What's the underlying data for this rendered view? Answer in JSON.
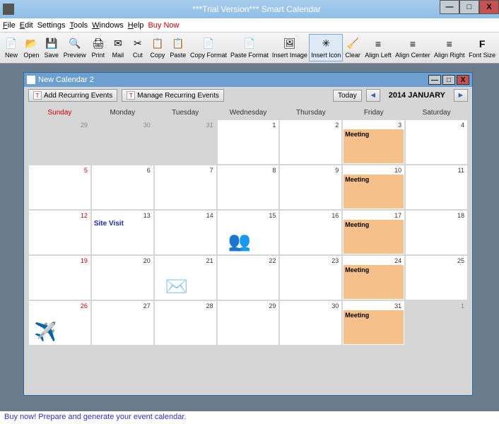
{
  "window": {
    "title": "***Trial Version*** Smart Calendar",
    "min": "—",
    "max": "□",
    "close": "X"
  },
  "menu": {
    "file": "File",
    "edit": "Edit",
    "settings": "Settings",
    "tools": "Tools",
    "windows": "Windows",
    "help": "Help",
    "buy": "Buy Now"
  },
  "toolbar": {
    "new": "New",
    "open": "Open",
    "save": "Save",
    "preview": "Preview",
    "print": "Print",
    "mail": "Mail",
    "cut": "Cut",
    "copy": "Copy",
    "paste": "Paste",
    "copyfmt": "Copy Format",
    "pastefmt": "Paste Format",
    "insertimg": "Insert Image",
    "inserticon": "Insert Icon",
    "clear": "Clear",
    "alignl": "Align Left",
    "alignc": "Align Center",
    "alignr": "Align Right",
    "fontsize": "Font Size"
  },
  "subwindow": {
    "title": "New Calendar 2",
    "addrecur": "Add Recurring Events",
    "managerecur": "Manage Recurring Events",
    "today": "Today",
    "month": "2014 JANUARY"
  },
  "dayheads": [
    "Sunday",
    "Monday",
    "Tuesday",
    "Wednesday",
    "Thursday",
    "Friday",
    "Saturday"
  ],
  "events": {
    "meeting": "Meeting",
    "sitevisit": "Site Visit"
  },
  "status": "Buy now! Prepare and generate your event calendar.",
  "cells": {
    "r0": [
      "29",
      "30",
      "31",
      "1",
      "2",
      "3",
      "4"
    ],
    "r1": [
      "5",
      "6",
      "7",
      "8",
      "9",
      "10",
      "11"
    ],
    "r2": [
      "12",
      "13",
      "14",
      "15",
      "16",
      "17",
      "18"
    ],
    "r3": [
      "19",
      "20",
      "21",
      "22",
      "23",
      "24",
      "25"
    ],
    "r4": [
      "26",
      "27",
      "28",
      "29",
      "30",
      "31",
      "1"
    ]
  }
}
